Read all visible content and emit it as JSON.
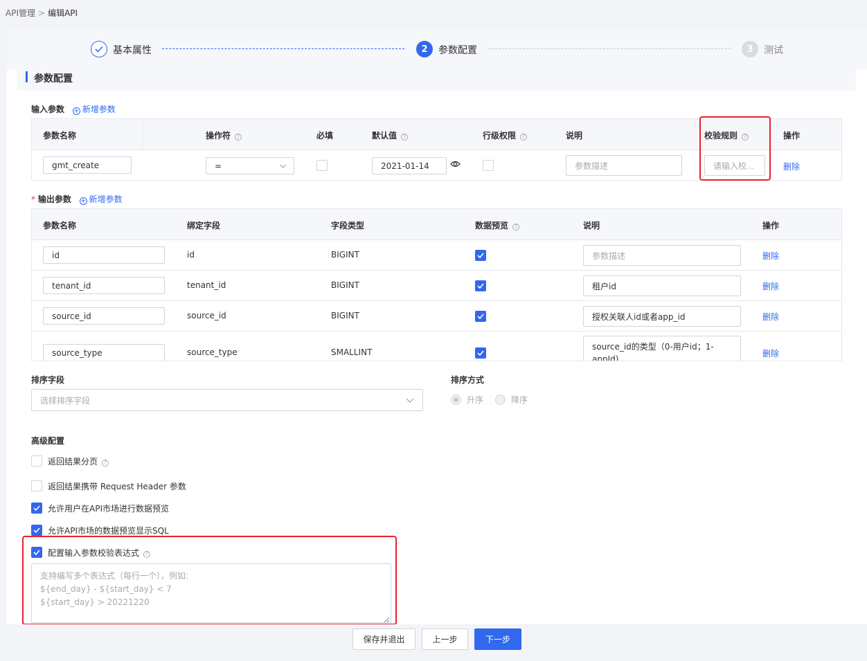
{
  "breadcrumb": {
    "root": "API管理",
    "sep": ">",
    "current": "编辑API"
  },
  "steps": [
    {
      "label": "基本属性",
      "state": "done"
    },
    {
      "num": "2",
      "label": "参数配置",
      "state": "active"
    },
    {
      "num": "3",
      "label": "测试",
      "state": "wait"
    }
  ],
  "section_title": "参数配置",
  "input_params": {
    "label": "输入参数",
    "add_label": "新增参数",
    "headers": [
      "参数名称",
      "操作符",
      "必填",
      "默认值",
      "行级权限",
      "说明",
      "校验规则",
      "操作"
    ],
    "rows": [
      {
        "name": "gmt_create",
        "operator": "=",
        "required": false,
        "default": "2021-01-14",
        "row_perm": false,
        "desc_placeholder": "参数描述",
        "rule_placeholder": "请输入校...",
        "action": "删除"
      }
    ]
  },
  "output_params": {
    "label": "输出参数",
    "add_label": "新增参数",
    "headers": [
      "参数名称",
      "绑定字段",
      "字段类型",
      "数据预览",
      "说明",
      "操作"
    ],
    "rows": [
      {
        "name": "id",
        "field": "id",
        "type": "BIGINT",
        "preview": true,
        "desc": "",
        "desc_placeholder": "参数描述",
        "action": "删除"
      },
      {
        "name": "tenant_id",
        "field": "tenant_id",
        "type": "BIGINT",
        "preview": true,
        "desc": "租户id",
        "action": "删除"
      },
      {
        "name": "source_id",
        "field": "source_id",
        "type": "BIGINT",
        "preview": true,
        "desc": "授权关联人id或者app_id",
        "action": "删除"
      },
      {
        "name": "source_type",
        "field": "source_type",
        "type": "SMALLINT",
        "preview": true,
        "desc_line1": "source_id的类型（0-用户id；1-",
        "desc_line2": "appId)",
        "action": "删除"
      }
    ]
  },
  "sort": {
    "field_label": "排序字段",
    "field_placeholder": "选择排序字段",
    "order_label": "排序方式",
    "asc": "升序",
    "desc": "降序"
  },
  "advanced": {
    "title": "高级配置",
    "options": [
      {
        "label": "返回结果分页",
        "checked": false,
        "help": true
      },
      {
        "label": "返回结果携带 Request Header 参数",
        "checked": false
      },
      {
        "label": "允许用户在API市场进行数据预览",
        "checked": true
      },
      {
        "label": "允许API市场的数据预览显示SQL",
        "checked": true
      },
      {
        "label": "配置输入参数校验表达式",
        "checked": true,
        "help": true
      }
    ],
    "expr_placeholder_lines": [
      "支持编写多个表达式（每行一个），例如:",
      "${end_day} - ${start_day} < 7",
      "${start_day} > 20221220"
    ]
  },
  "footer": {
    "save_exit": "保存并退出",
    "prev": "上一步",
    "next": "下一步"
  },
  "colors": {
    "primary": "#3268ef",
    "highlight": "#e8202f"
  }
}
